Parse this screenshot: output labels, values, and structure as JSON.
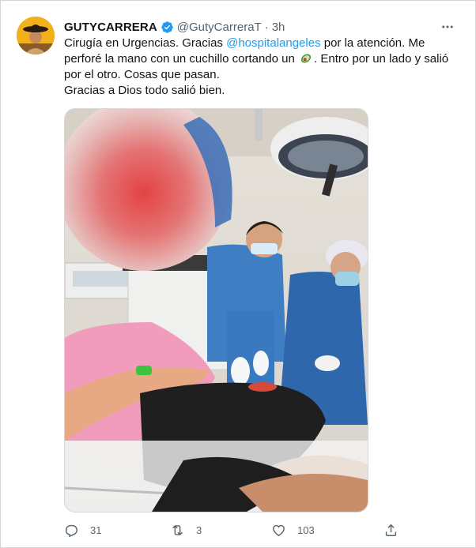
{
  "tweet": {
    "author_name": "GUTYCARRERA",
    "handle": "@GutyCarreraT",
    "separator": "·",
    "timestamp": "3h",
    "text": {
      "line1_a": "Cirugía en Urgencias. Gracias ",
      "mention": "@hospitalangeles",
      "line1_b": " por la atención. Me perforé la mano con un cuchillo cortando un ",
      "line1_c": ". Entro por un lado y salió por el otro. Cosas que pasan.",
      "line2": "Gracias a Dios todo salió bien."
    }
  },
  "actions": {
    "replies": "31",
    "retweets": "3",
    "likes": "103"
  },
  "icons": {
    "verified": "verified-badge-icon",
    "more": "more-options-icon",
    "reply": "reply-icon",
    "retweet": "retweet-icon",
    "like": "heart-icon",
    "share": "share-icon",
    "emoji": "avocado-emoji"
  },
  "colors": {
    "accent": "#1d9bf0",
    "text": "#0f1419",
    "secondary": "#536471"
  }
}
